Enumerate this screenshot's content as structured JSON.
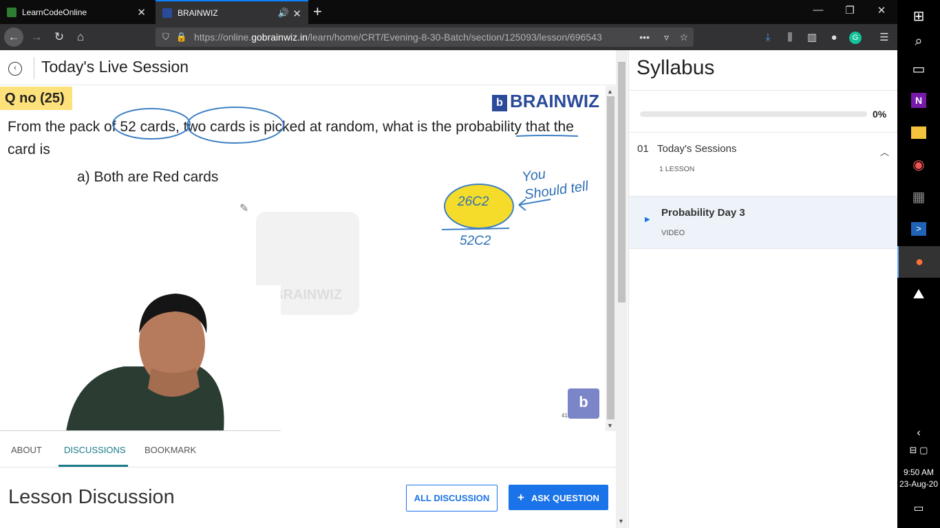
{
  "browser": {
    "tabs": [
      {
        "title": "LearnCodeOnline"
      },
      {
        "title": "BRAINWIZ"
      }
    ],
    "url_prefix": "https://online.",
    "url_host": "gobrainwiz.in",
    "url_path": "/learn/home/CRT/Evening-8-30-Batch/section/125093/lesson/696543"
  },
  "page": {
    "title": "Today's Live Session"
  },
  "video": {
    "question_no": "Q no (25)",
    "question_text": "From the pack of 52 cards, two cards is picked at random, what is the probability that the card is",
    "option": "a) Both are Red cards",
    "brand": "BRAINWIZ",
    "watermark": "BRAINWIZ",
    "annotations": {
      "numerator": "26C2",
      "denominator": "52C2",
      "note": "You Should tell"
    },
    "mini_number": "41"
  },
  "tabs": [
    {
      "label": "ABOUT"
    },
    {
      "label": "DISCUSSIONS"
    },
    {
      "label": "BOOKMARK"
    }
  ],
  "discussion": {
    "title": "Lesson Discussion",
    "all_button": "ALL DISCUSSION",
    "ask_button": "ASK QUESTION"
  },
  "syllabus": {
    "title": "Syllabus",
    "progress_pct": "0%",
    "progress_value": 0,
    "section": {
      "number": "01",
      "title": "Today's Sessions",
      "count": "1 LESSON"
    },
    "lesson": {
      "title": "Probability Day 3",
      "type": "VIDEO"
    }
  },
  "clock": {
    "time": "9:50 AM",
    "date": "23-Aug-20"
  }
}
